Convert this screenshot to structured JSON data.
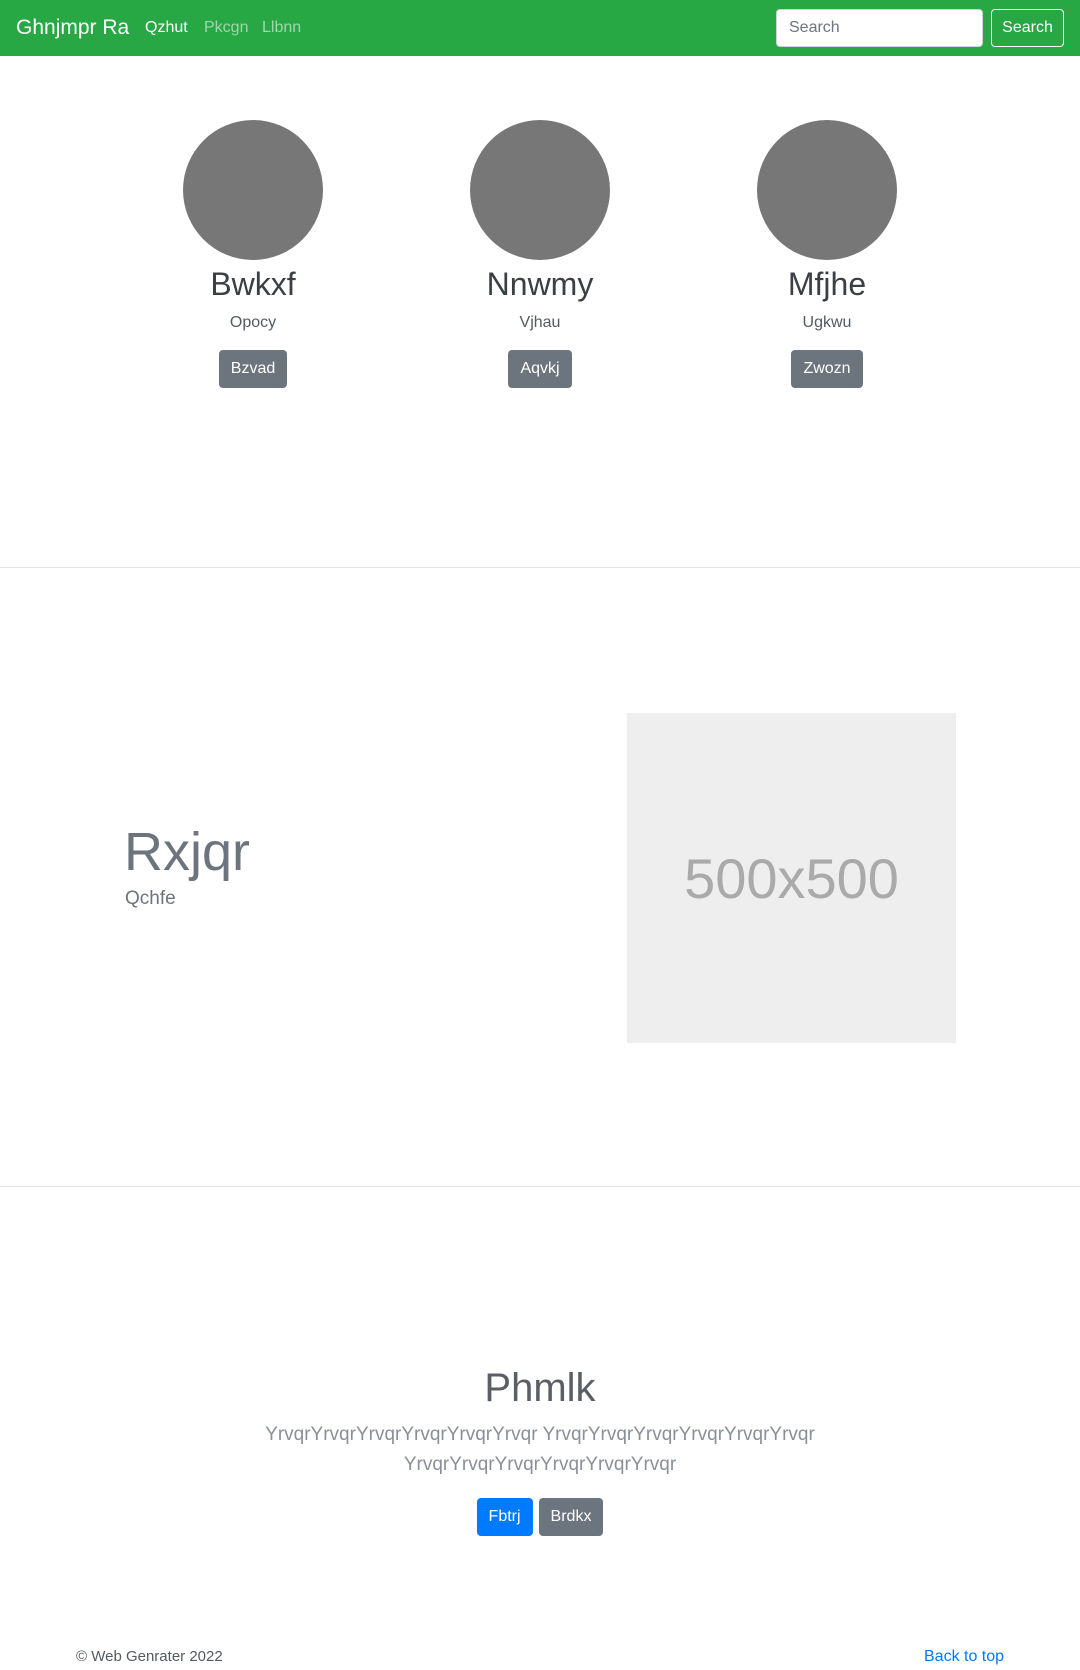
{
  "navbar": {
    "brand": "Ghnjmpr Ra",
    "links": [
      "Qzhut",
      "Pkcgn",
      "Llbnn"
    ],
    "search_placeholder": "Search",
    "search_button": "Search",
    "colors": {
      "background": "#28a745"
    }
  },
  "team": {
    "members": [
      {
        "name": "Bwkxf",
        "role": "Opocy",
        "button": "Bzvad"
      },
      {
        "name": "Nnwmy",
        "role": "Vjhau",
        "button": "Aqvkj"
      },
      {
        "name": "Mfjhe",
        "role": "Ugkwu",
        "button": "Zwozn"
      }
    ]
  },
  "feature": {
    "title": "Rxjqr",
    "subtitle": "Qchfe",
    "image_label": "500x500"
  },
  "jumbo": {
    "title": "Phmlk",
    "text": "YrvqrYrvqrYrvqrYrvqrYrvqrYrvqr YrvqrYrvqrYrvqrYrvqrYrvqrYrvqr YrvqrYrvqrYrvqrYrvqrYrvqrYrvqr",
    "primary_button": "Fbtrj",
    "secondary_button": "Brdkx",
    "colors": {
      "primary": "#007bff",
      "secondary": "#6c757d"
    }
  },
  "footer": {
    "copyright": "© Web Genrater 2022",
    "back_to_top": "Back to top"
  }
}
